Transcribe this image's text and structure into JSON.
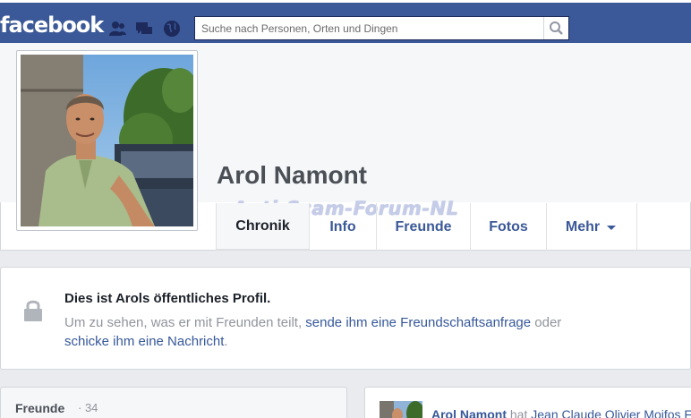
{
  "topbar": {
    "logo": "facebook",
    "search_placeholder": "Suche nach Personen, Orten und Dingen"
  },
  "profile": {
    "name": "Arol Namont",
    "watermark": "Anti-Scam-Forum-NL"
  },
  "tabs": [
    {
      "label": "Chronik",
      "active": true
    },
    {
      "label": "Info"
    },
    {
      "label": "Freunde"
    },
    {
      "label": "Fotos"
    },
    {
      "label": "Mehr"
    }
  ],
  "notice": {
    "title": "Dies ist Arols öffentliches Profil.",
    "text_part1": "Um zu sehen, was er mit Freunden teilt, ",
    "link_friend_request": "sende ihm eine Freundschaftsanfrage",
    "text_part2": " oder",
    "link_message": "schicke ihm eine Nachricht",
    "text_part3": "."
  },
  "friends": {
    "title": "Freunde",
    "count": "· 34"
  },
  "feed": {
    "author": "Arol Namont",
    "verb": " hat ",
    "target": "Jean Claude Olivier Moifos Fo..."
  },
  "colors": {
    "brand_blue": "#3b5998",
    "link_blue": "#365899",
    "page_bg": "#e9ebee"
  }
}
